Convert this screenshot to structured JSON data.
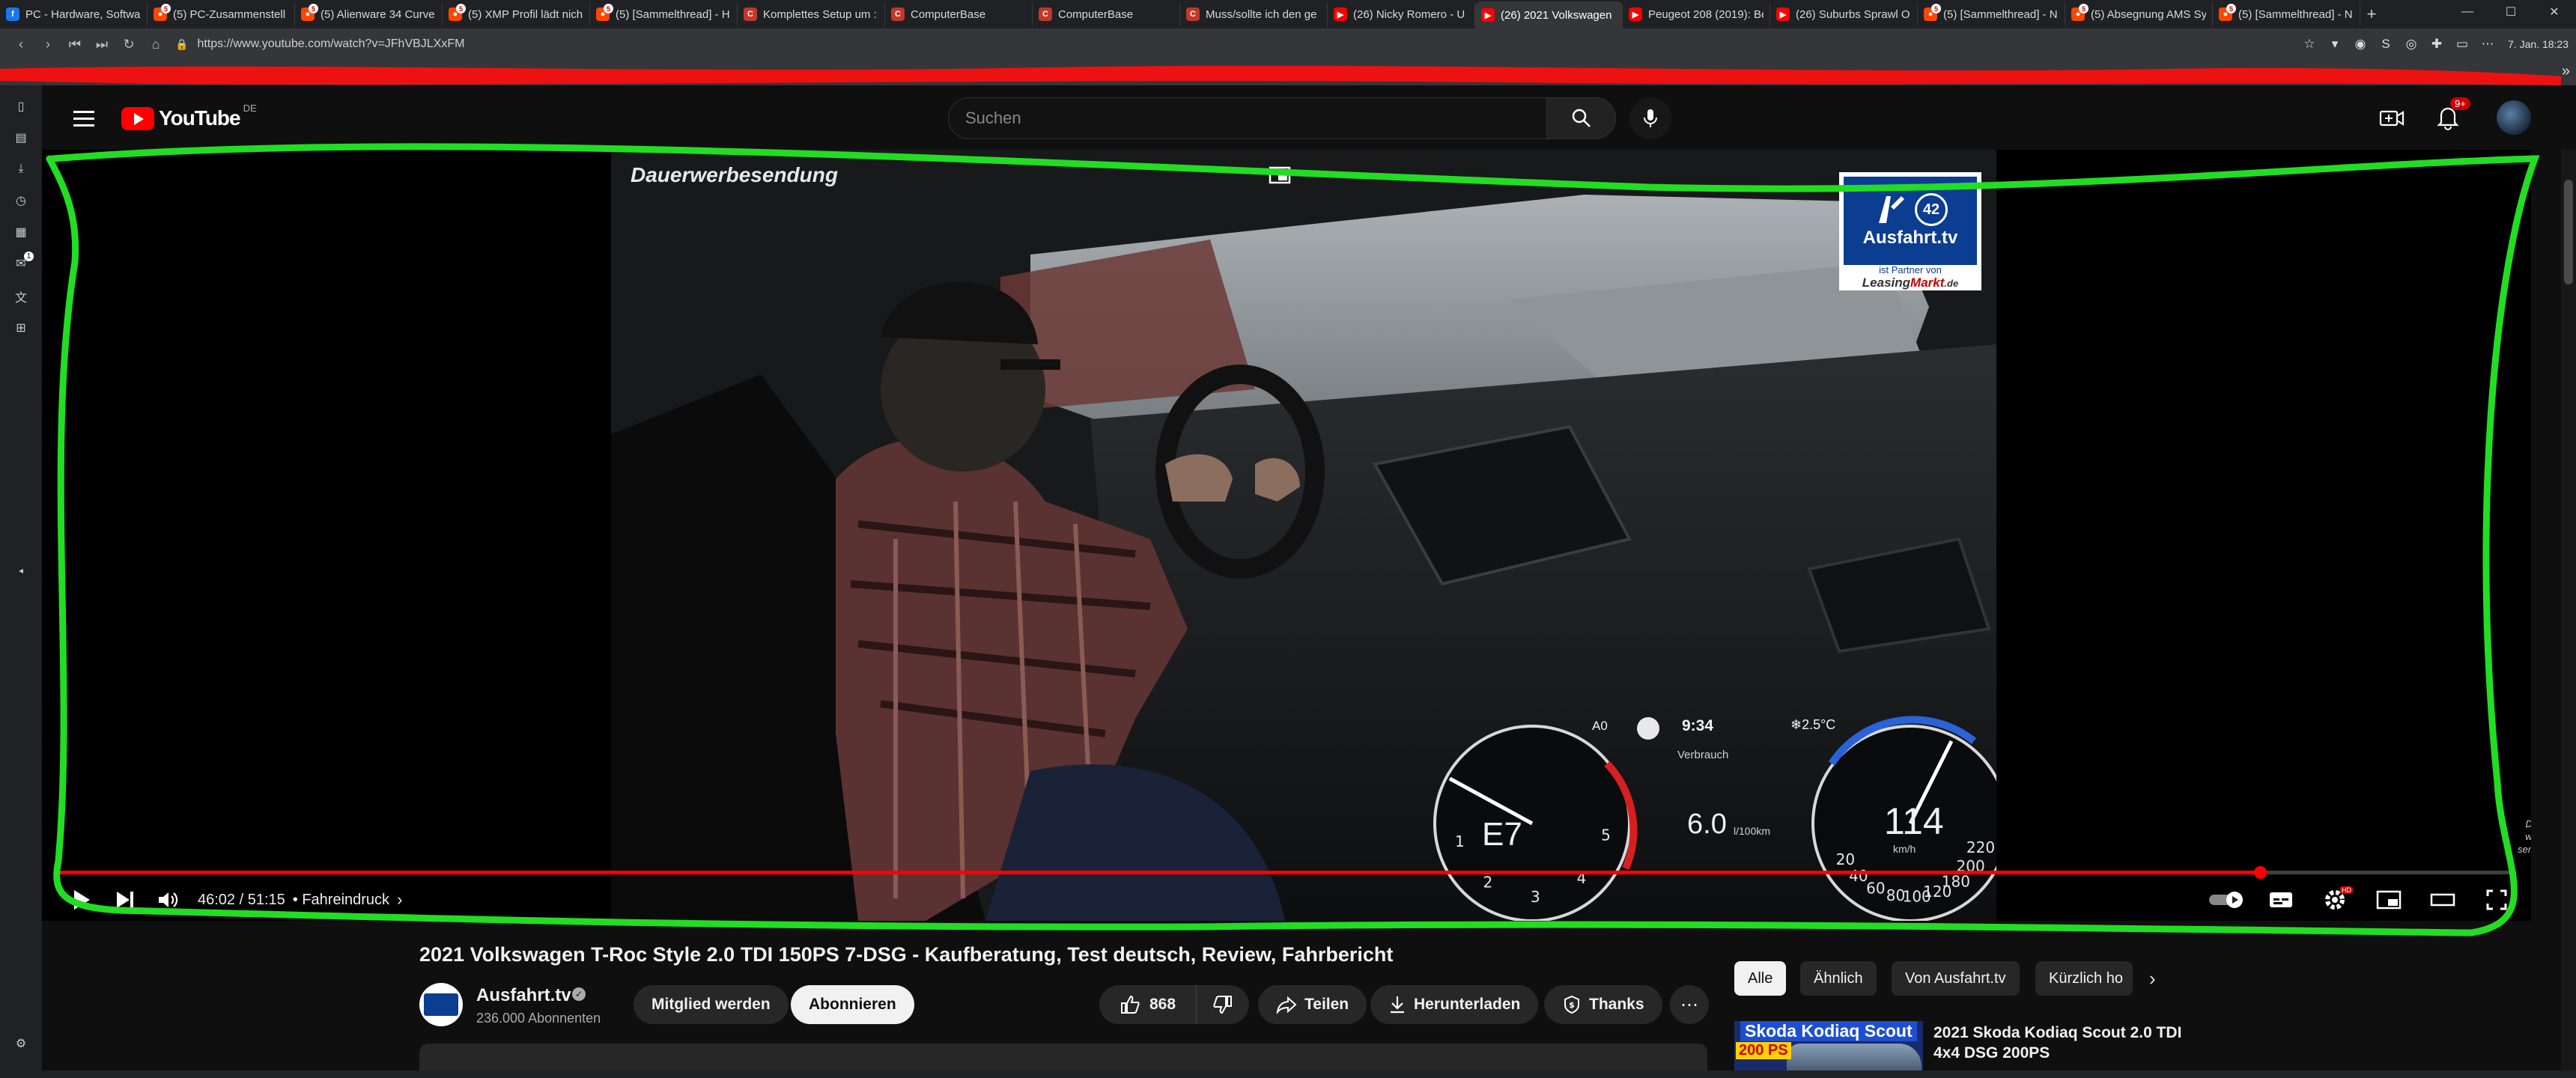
{
  "browser": {
    "tabs": [
      {
        "title": "PC - Hardware, Softwar",
        "favicon": "facebook",
        "badge": ""
      },
      {
        "title": "(5) PC-Zusammenstell",
        "favicon": "reddit",
        "badge": "5"
      },
      {
        "title": "(5) Alienware 34 Curve",
        "favicon": "reddit",
        "badge": "5"
      },
      {
        "title": "(5) XMP Profil lädt nich",
        "favicon": "reddit",
        "badge": "5"
      },
      {
        "title": "(5) [Sammelthread] - H",
        "favicon": "reddit",
        "badge": "5"
      },
      {
        "title": "Komplettes Setup um :",
        "favicon": "computerbase",
        "badge": ""
      },
      {
        "title": "ComputerBase",
        "favicon": "computerbase",
        "badge": ""
      },
      {
        "title": "ComputerBase",
        "favicon": "computerbase",
        "badge": ""
      },
      {
        "title": "Muss/sollte ich den ge",
        "favicon": "computerbase",
        "badge": ""
      },
      {
        "title": "(26) Nicky Romero - U",
        "favicon": "youtube",
        "badge": ""
      },
      {
        "title": "(26) 2021 Volkswagen",
        "favicon": "youtube",
        "badge": "",
        "active": true
      },
      {
        "title": "Peugeot 208 (2019): Be",
        "favicon": "youtube",
        "badge": ""
      },
      {
        "title": "(26) Suburbs Sprawl O",
        "favicon": "youtube",
        "badge": ""
      },
      {
        "title": "(5) [Sammelthread] - N",
        "favicon": "reddit",
        "badge": "5"
      },
      {
        "title": "(5) Absegnung AMS Sy",
        "favicon": "reddit",
        "badge": "5"
      },
      {
        "title": "(5) [Sammelthread] - N",
        "favicon": "reddit",
        "badge": "5"
      }
    ],
    "url": "https://www.youtube.com/watch?v=JFhVBJLXxFM",
    "clock": "7. Jan. 18:23",
    "sidebar_badge": "1"
  },
  "youtube": {
    "country": "DE",
    "wordmark": "YouTube",
    "search_placeholder": "Suchen",
    "notifications": "9+"
  },
  "player": {
    "ad_label": "Dauerwerbesendung",
    "timecode": "46:02 / 51:15",
    "chapter": "• Fahreindruck",
    "progress_fraction": 0.896,
    "corner_note": "Dauer-werbe-sendung",
    "overlay_logo": {
      "brand": "Ausfahrt.tv",
      "number": "42",
      "partner_line": "ist Partner von",
      "partner_a": "Leasing",
      "partner_b": "Markt",
      "partner_c": ".de"
    },
    "dashboard": {
      "gear": "E7",
      "time": "9:34",
      "temperature": "❄2.5°C",
      "eco": "A0",
      "label": "Verbrauch",
      "consumption": "6.0",
      "consumption_unit": "l/100km",
      "speed": "114",
      "speed_unit": "km/h",
      "rpm_ticks": [
        "1",
        "2",
        "3",
        "4",
        "5"
      ],
      "speed_ticks": [
        "20",
        "40",
        "60",
        "80",
        "100",
        "120",
        "180",
        "200",
        "220"
      ]
    }
  },
  "video": {
    "title": "2021 Volkswagen T-Roc Style 2.0 TDI 150PS 7-DSG - Kaufberatung, Test deutsch, Review, Fahrbericht",
    "channel": "Ausfahrt.tv",
    "subscribers": "236.000 Abonnenten",
    "join_label": "Mitglied werden",
    "subscribe_label": "Abonnieren",
    "likes": "868",
    "share_label": "Teilen",
    "download_label": "Herunterladen",
    "thanks_label": "Thanks"
  },
  "recommendations": {
    "chips": [
      "Alle",
      "Ähnlich",
      "Von Ausfahrt.tv",
      "Kürzlich ho"
    ],
    "first": {
      "thumb_label": "Skoda Kodiaq Scout",
      "thumb_ps": "200 PS",
      "title": "2021 Skoda Kodiaq Scout 2.0 TDI 4x4 DSG 200PS"
    }
  },
  "annotations": {
    "green_outline_color": "#22dd22",
    "red_mark_color": "#ee1111"
  }
}
